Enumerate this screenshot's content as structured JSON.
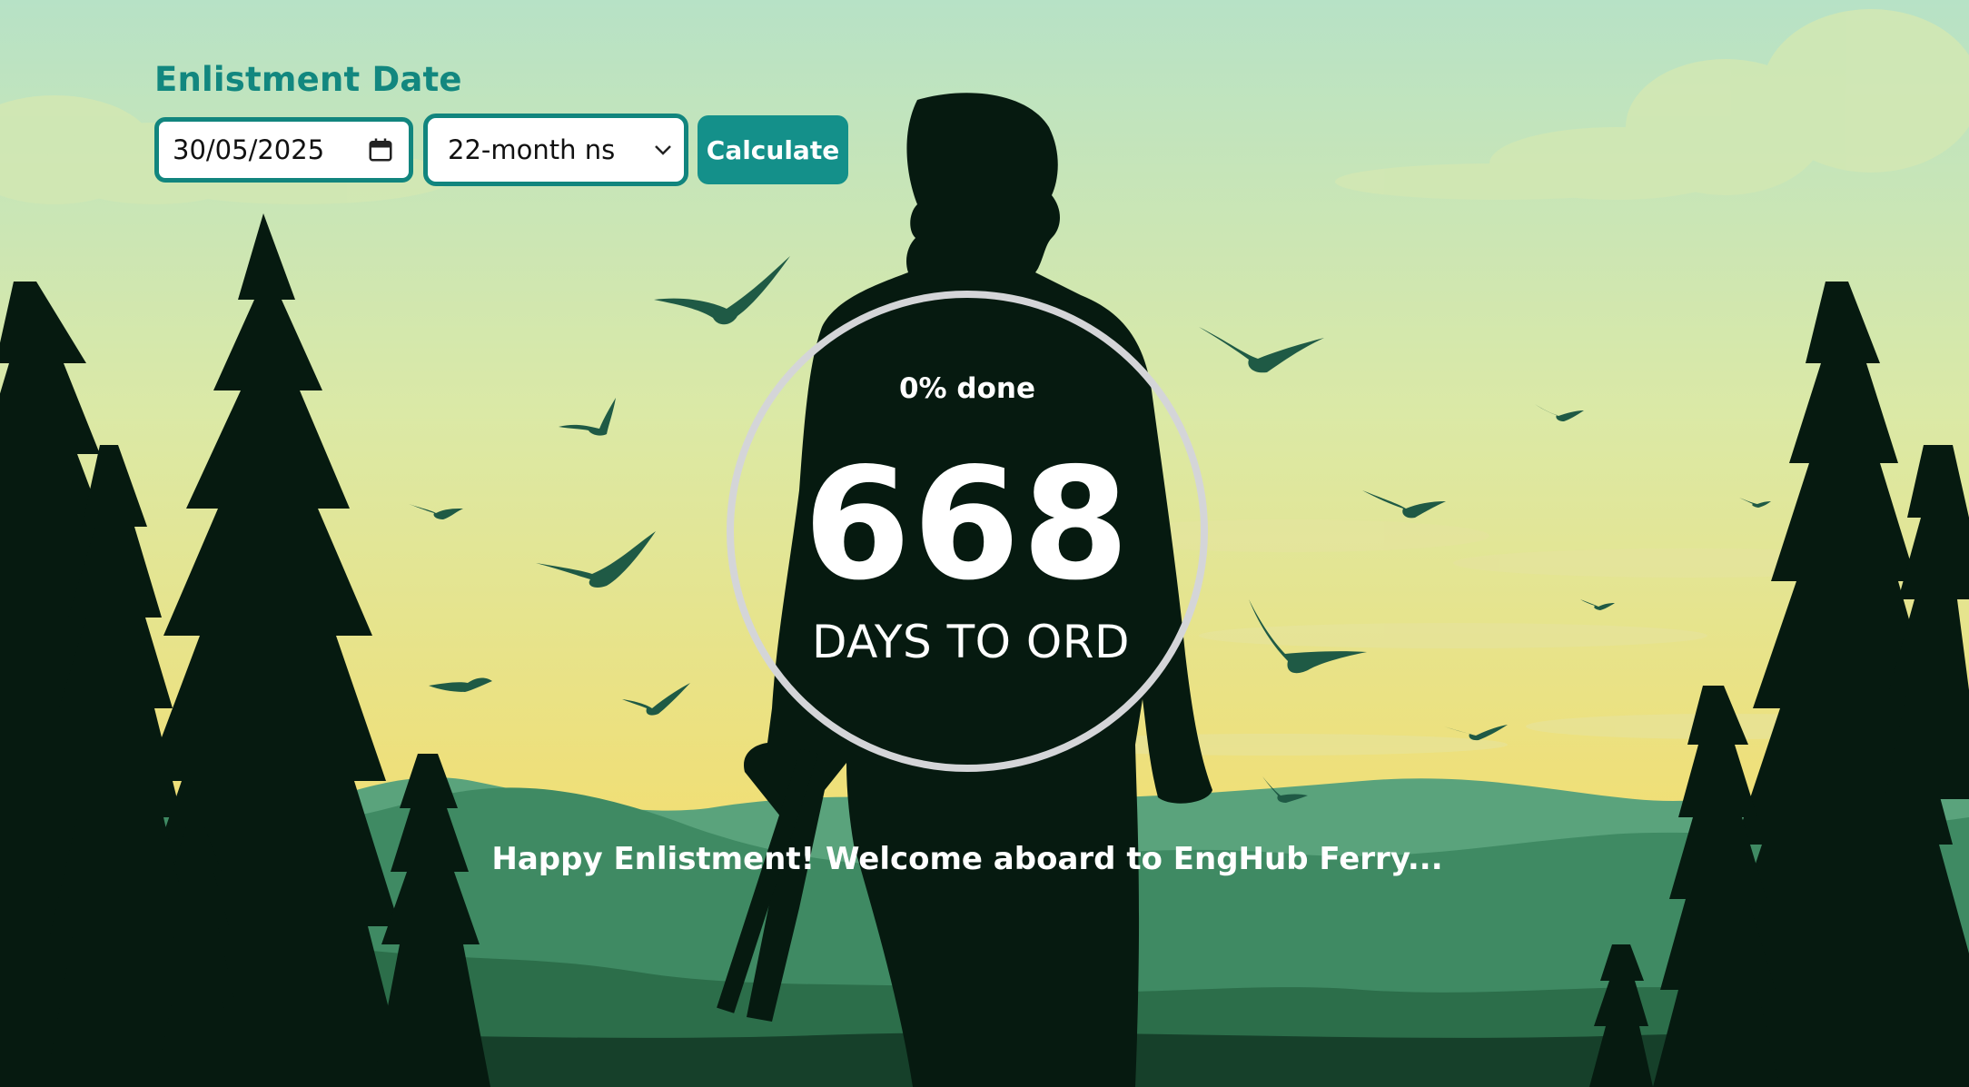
{
  "form": {
    "label": "Enlistment Date",
    "date_value": "30/05/2025",
    "service_selected": "22-month ns",
    "calculate_label": "Calculate"
  },
  "progress": {
    "percent_text": "0% done",
    "percent_value": 0,
    "days_remaining": "668",
    "days_label": "DAYS TO ORD"
  },
  "message": "Happy Enlistment! Welcome aboard to EngHub Ferry...",
  "colors": {
    "accent": "#12877f",
    "sky_top": "#b7e2c6",
    "sky_bottom": "#f2de72",
    "silhouette": "#061a10",
    "ring": "#d4d5d8"
  },
  "icons": {
    "date": "calendar-icon",
    "select": "chevron-down-icon"
  }
}
